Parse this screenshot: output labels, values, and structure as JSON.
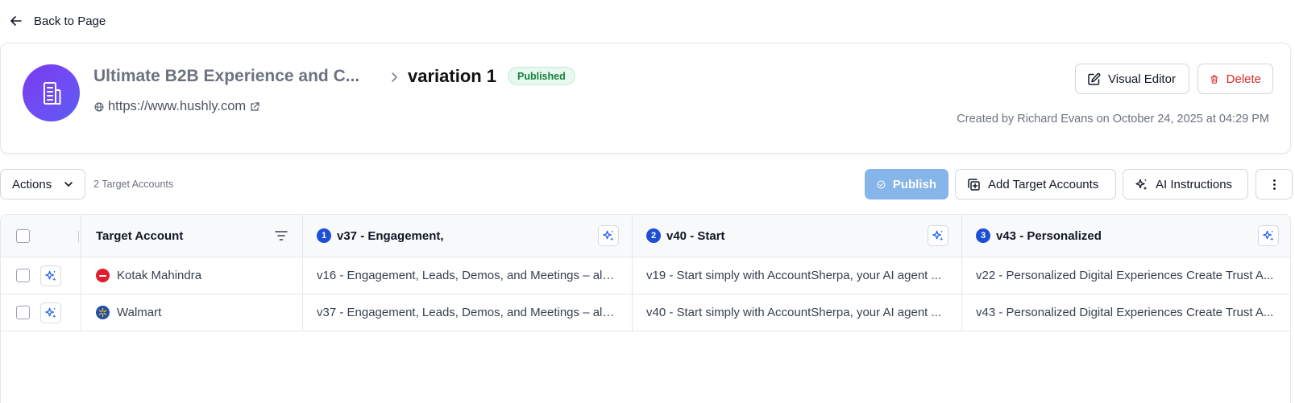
{
  "nav": {
    "back_label": "Back to Page"
  },
  "header": {
    "page_name": "Ultimate B2B Experience and C...",
    "variation_name": "variation 1",
    "status": "Published",
    "url": "https://www.hushly.com",
    "visual_editor_label": "Visual Editor",
    "delete_label": "Delete",
    "created_info": "Created by Richard Evans on October 24, 2025 at 04:29 PM"
  },
  "toolbar": {
    "actions_label": "Actions",
    "target_count": "2 Target Accounts",
    "publish_label": "Publish",
    "add_targets_label": "Add Target Accounts",
    "ai_instructions_label": "AI Instructions"
  },
  "table": {
    "columns": [
      {
        "label": "Target Account"
      },
      {
        "number": "1",
        "label": "v37 - Engagement,"
      },
      {
        "number": "2",
        "label": "v40 - Start"
      },
      {
        "number": "3",
        "label": "v43 - Personalized"
      }
    ],
    "rows": [
      {
        "account": "Kotak Mahindra",
        "cells": [
          "v16 - Engagement, Leads, Demos, and Meetings – all ...",
          "v19 - Start simply with AccountSherpa, your AI agent ...",
          "v22 - Personalized Digital Experiences Create Trust A..."
        ]
      },
      {
        "account": "Walmart",
        "cells": [
          "v37 - Engagement, Leads, Demos, and Meetings – all ...",
          "v40 - Start simply with AccountSherpa, your AI agent ...",
          "v43 - Personalized Digital Experiences Create Trust A..."
        ]
      }
    ]
  },
  "colors": {
    "accent": "#1d4ed8",
    "avatar": "#7c3aed",
    "publish": "#86b5ea",
    "published_badge": "#15803d",
    "delete": "#dc2626",
    "kotak_logo": "#e11d2e",
    "walmart_logo": "#1e4fa8"
  },
  "icons": {
    "back": "arrow-left-icon",
    "avatar": "building-icon",
    "crumb": "chevron-right-icon",
    "globe": "globe-icon",
    "external": "external-link-icon",
    "visual_editor": "edit-icon",
    "delete": "trash-icon",
    "dropdown": "chevron-down-icon",
    "publish": "check-circle-icon",
    "add": "add-square-icon",
    "ai": "sparkle-icon",
    "more": "more-vertical-icon",
    "filter": "filter-icon"
  }
}
